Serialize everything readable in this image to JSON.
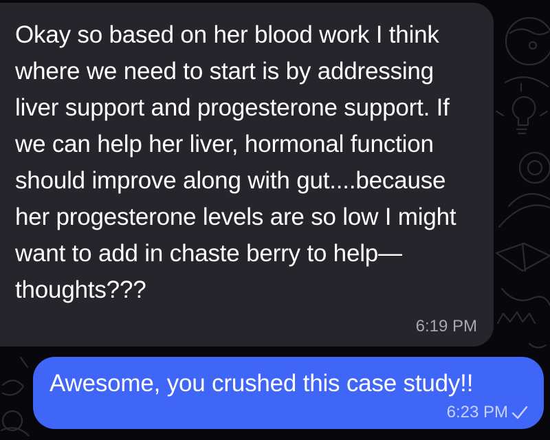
{
  "colors": {
    "background": "#08080c",
    "incoming_bubble": "#26252c",
    "outgoing_bubble": "#3f66f6",
    "incoming_time_text": "#a7a7ad",
    "outgoing_time_text": "#c9d3ff"
  },
  "messages": [
    {
      "direction": "incoming",
      "text": "Okay so based on her blood work I think where we need to start is by addressing liver support and progesterone support. If we can help her liver, hormonal function should improve along with gut....because her progesterone levels are so low I might want to add in chaste berry to help—thoughts???",
      "time": "6:19 PM"
    },
    {
      "direction": "outgoing",
      "text": "Awesome, you crushed this case study!!",
      "time": "6:23 PM",
      "status_icon": "check-icon"
    }
  ]
}
